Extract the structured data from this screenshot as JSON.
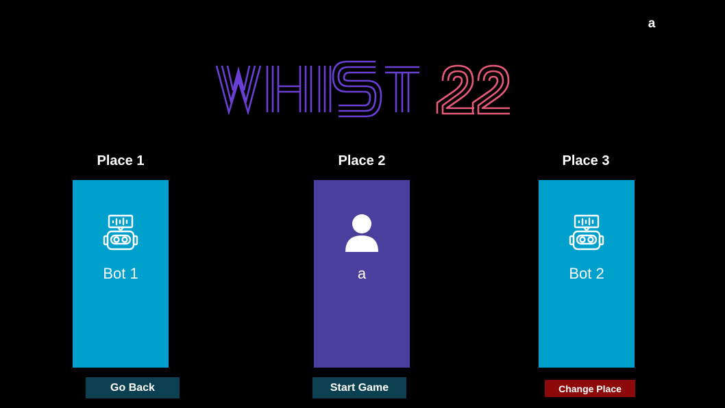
{
  "header": {
    "username": "a",
    "logo_text_1": "WHIST",
    "logo_text_2": "22"
  },
  "places": [
    {
      "label": "Place 1",
      "player_name": "Bot 1",
      "player_type": "bot",
      "icon": "robot-icon",
      "card_color": "#00a0cc"
    },
    {
      "label": "Place 2",
      "player_name": "a",
      "player_type": "human",
      "icon": "user-icon",
      "card_color": "#4b3f9e"
    },
    {
      "label": "Place 3",
      "player_name": "Bot 2",
      "player_type": "bot",
      "icon": "robot-icon",
      "card_color": "#00a0cc"
    }
  ],
  "actions": {
    "go_back": "Go Back",
    "start_game": "Start Game",
    "change_place": "Change Place"
  },
  "colors": {
    "background": "#000000",
    "logo_purple": "#6a3fd4",
    "logo_pink": "#e85a7a",
    "bot_card": "#00a0cc",
    "human_card": "#4b3f9e",
    "button_dark": "#0b4050",
    "button_red": "#8e0a0a"
  }
}
